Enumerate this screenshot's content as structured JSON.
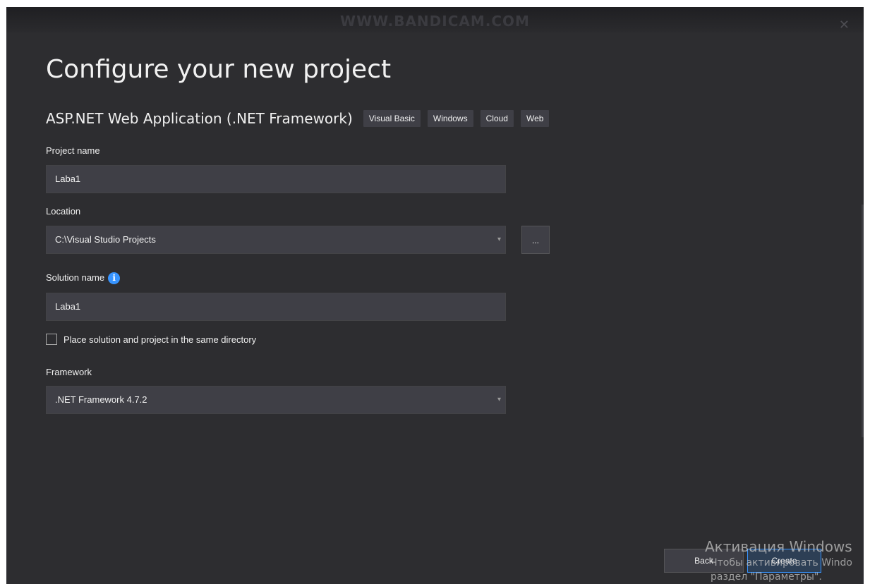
{
  "watermark": "WWW.BANDICAM.COM",
  "dialog": {
    "title": "Configure your new project",
    "close_glyph": "✕"
  },
  "template": {
    "name": "ASP.NET Web Application (.NET Framework)",
    "tags": [
      "Visual Basic",
      "Windows",
      "Cloud",
      "Web"
    ]
  },
  "project_name": {
    "label": "Project name",
    "value": "Laba1"
  },
  "location": {
    "label": "Location",
    "value": "C:\\Visual Studio Projects",
    "browse_label": "..."
  },
  "solution_name": {
    "label": "Solution name",
    "value": "Laba1",
    "info_icon": "i"
  },
  "same_directory": {
    "label": "Place solution and project in the same directory",
    "checked": false
  },
  "framework": {
    "label": "Framework",
    "value": ".NET Framework 4.7.2"
  },
  "buttons": {
    "back": "Back",
    "create": "Create"
  },
  "activation_overlay": {
    "title": "Активация Windows",
    "line1": "Чтобы активировать Windo",
    "line2": "раздел \"Параметры\"."
  },
  "colors": {
    "background": "#2d2d30",
    "input": "#3f3f46",
    "text": "#f1f1f1",
    "accent": "#3794ff"
  },
  "icons": {
    "dropdown": "chevron-down-icon",
    "info": "info-icon",
    "close": "close-icon"
  }
}
